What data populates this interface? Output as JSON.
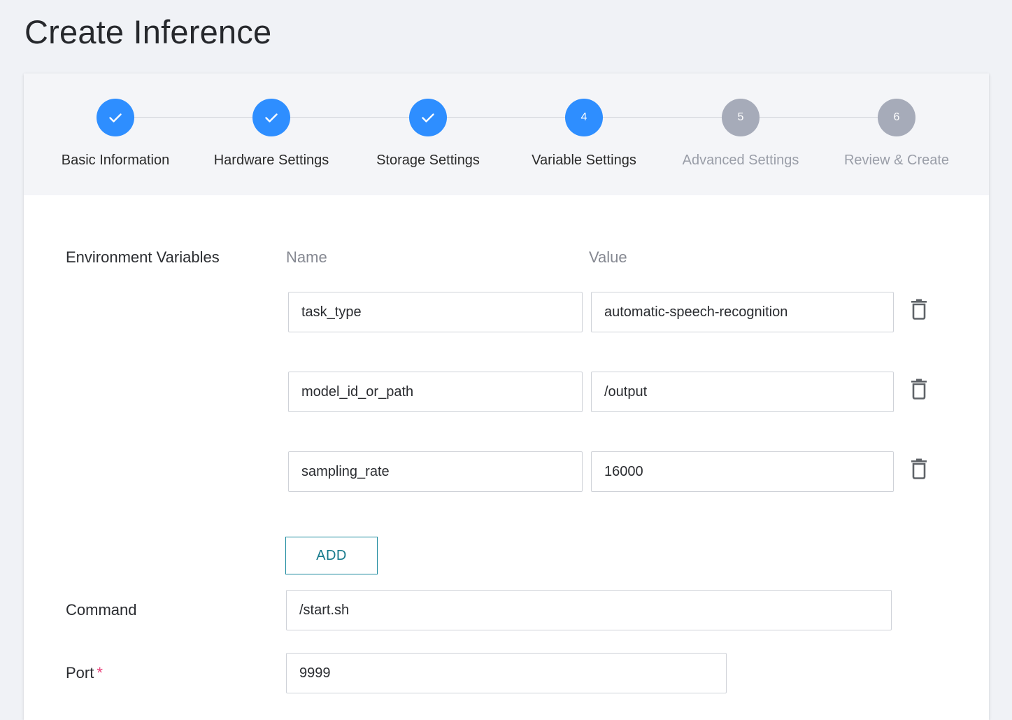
{
  "page": {
    "title": "Create Inference"
  },
  "stepper": {
    "steps": [
      {
        "number": "1",
        "label": "Basic Information",
        "state": "done"
      },
      {
        "number": "2",
        "label": "Hardware Settings",
        "state": "done"
      },
      {
        "number": "3",
        "label": "Storage Settings",
        "state": "done"
      },
      {
        "number": "4",
        "label": "Variable Settings",
        "state": "active"
      },
      {
        "number": "5",
        "label": "Advanced Settings",
        "state": "todo"
      },
      {
        "number": "6",
        "label": "Review & Create",
        "state": "todo"
      }
    ]
  },
  "env": {
    "label": "Environment Variables",
    "name_header": "Name",
    "value_header": "Value",
    "rows": [
      {
        "name": "task_type",
        "value": "automatic-speech-recognition"
      },
      {
        "name": "model_id_or_path",
        "value": "/output"
      },
      {
        "name": "sampling_rate",
        "value": "16000"
      }
    ],
    "add_label": "ADD"
  },
  "command": {
    "label": "Command",
    "value": "/start.sh"
  },
  "port": {
    "label": "Port",
    "required_mark": "*",
    "value": "9999"
  },
  "colors": {
    "accent": "#2e8eff",
    "inactive_step": "#a6abb9",
    "add_button": "#177a8c",
    "required": "#e8417a"
  }
}
